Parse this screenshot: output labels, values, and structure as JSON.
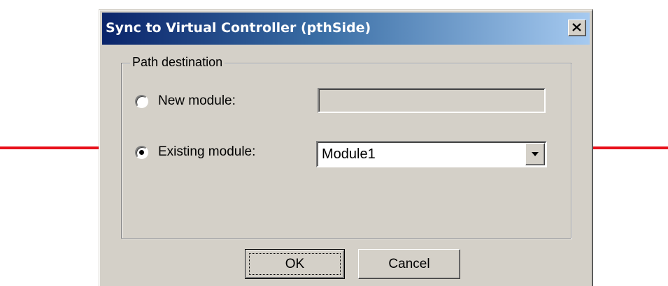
{
  "dialog": {
    "title": "Sync to Virtual Controller (pthSide)",
    "close_icon": "close-x-icon"
  },
  "group": {
    "legend": "Path destination",
    "new_module": {
      "label": "New module:",
      "selected": false,
      "field_value": ""
    },
    "existing_module": {
      "label": "Existing module:",
      "selected": true,
      "combo_value": "Module1",
      "dropdown_icon": "chevron-down-icon"
    }
  },
  "buttons": {
    "ok_label": "OK",
    "cancel_label": "Cancel"
  },
  "annotations": {
    "arrow_color": "#e8101a",
    "left_arrow_icon": "arrow-right-icon",
    "right_arrow_icon": "arrow-left-icon"
  },
  "colors": {
    "dialog_face": "#d4d0c8",
    "title_gradient_start": "#0a246a",
    "title_gradient_end": "#a6caf0"
  }
}
